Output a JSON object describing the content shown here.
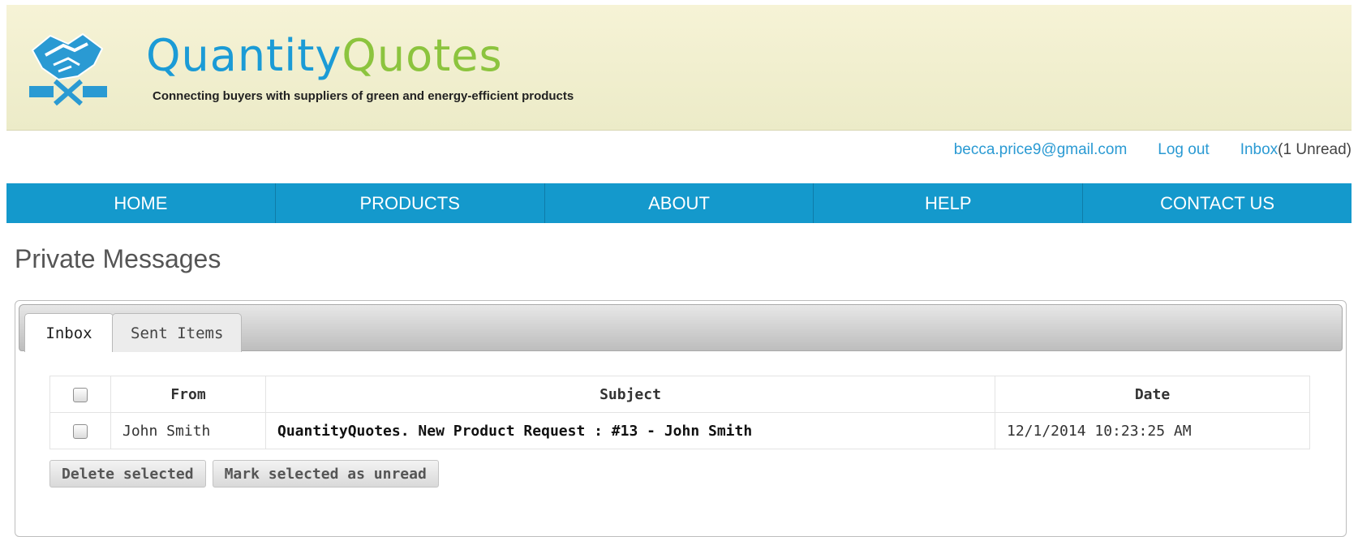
{
  "header": {
    "logo_part1": "Quantity",
    "logo_part2": "Quotes",
    "tagline": "Connecting buyers with suppliers of green and energy-efficient products",
    "logo_icon": "handshake-icon"
  },
  "userbar": {
    "email": "becca.price9@gmail.com",
    "logout": "Log out",
    "inbox": "Inbox",
    "unread": "(1 Unread)"
  },
  "nav": [
    {
      "label": "HOME"
    },
    {
      "label": "PRODUCTS"
    },
    {
      "label": "ABOUT"
    },
    {
      "label": "HELP"
    },
    {
      "label": "CONTACT US"
    }
  ],
  "page_title": "Private Messages",
  "tabs": [
    {
      "label": "Inbox",
      "active": true
    },
    {
      "label": "Sent Items",
      "active": false
    }
  ],
  "table": {
    "headers": {
      "from": "From",
      "subject": "Subject",
      "date": "Date"
    },
    "rows": [
      {
        "from": "John Smith",
        "subject": "QuantityQuotes. New Product Request : #13 - John Smith",
        "date": "12/1/2014 10:23:25 AM"
      }
    ]
  },
  "actions": {
    "delete": "Delete selected",
    "mark_unread": "Mark selected as unread"
  },
  "colors": {
    "nav_bg": "#1499cc",
    "brand_blue": "#1b9bd6",
    "brand_green": "#8cc43e"
  }
}
